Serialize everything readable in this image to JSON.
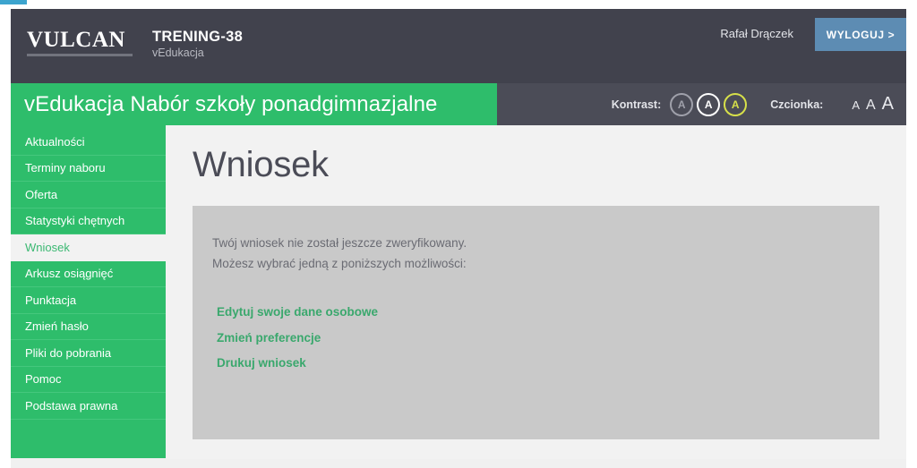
{
  "header": {
    "logo_word": "VULCAN",
    "app_title": "TRENING-38",
    "app_subtitle": "vEdukacja",
    "user_name": "Rafał Drączek",
    "logout_label": "WYLOGUJ >"
  },
  "banner": {
    "title": "vEdukacja Nabór szkoły ponadgimnazjalne",
    "contrast_label": "Kontrast:",
    "contrast_options": [
      "A",
      "A",
      "A"
    ],
    "contrast_selected_index": 2,
    "font_label": "Czcionka:",
    "font_options": [
      "A",
      "A",
      "A"
    ]
  },
  "sidebar": {
    "items": [
      {
        "label": "Aktualności",
        "active": false
      },
      {
        "label": "Terminy naboru",
        "active": false
      },
      {
        "label": "Oferta",
        "active": false
      },
      {
        "label": "Statystyki chętnych",
        "active": false
      },
      {
        "label": "Wniosek",
        "active": true
      },
      {
        "label": "Arkusz osiągnięć",
        "active": false
      },
      {
        "label": "Punktacja",
        "active": false
      },
      {
        "label": "Zmień hasło",
        "active": false
      },
      {
        "label": "Pliki do pobrania",
        "active": false
      },
      {
        "label": "Pomoc",
        "active": false
      },
      {
        "label": "Podstawa prawna",
        "active": false
      }
    ]
  },
  "main": {
    "page_title": "Wniosek",
    "panel": {
      "line1": "Twój wniosek nie został jeszcze zweryfikowany.",
      "line2": "Możesz wybrać jedną z poniższych możliwości:",
      "links": [
        "Edytuj swoje dane osobowe",
        "Zmień preferencje",
        "Drukuj wniosek"
      ]
    }
  },
  "colors": {
    "green": "#2ebd6b",
    "dark": "#41424d",
    "dark_alt": "#4b4c57",
    "logout_blue": "#5d8cb3",
    "panel_gray": "#c9c9c9",
    "link_green": "#3aa86d",
    "contrast_highlight": "#d7e04a",
    "top_strip_blue": "#3ca4ce"
  }
}
